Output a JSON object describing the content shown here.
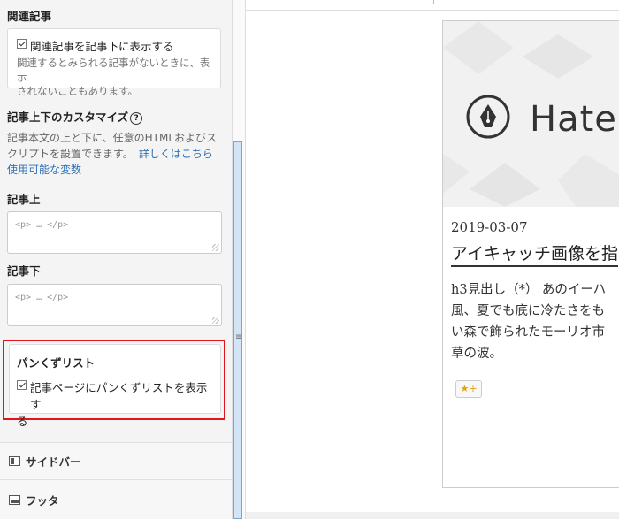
{
  "sidebar": {
    "related": {
      "heading": "関連記事",
      "checkbox_label": "関連記事を記事下に表示する",
      "hint_line1": "関連するとみられる記事がないときに、表示",
      "hint_line2": "されないこともあります。"
    },
    "customize": {
      "heading": "記事上下のカスタマイズ",
      "help_icon": "?",
      "desc_line1": "記事本文の上と下に、任意のHTMLおよびス",
      "desc_line2": "クリプトを設置できます。",
      "details_link": "詳しくはこちら",
      "vars_link": "使用可能な変数"
    },
    "above": {
      "label": "記事上",
      "placeholder": "<p> … </p>"
    },
    "below": {
      "label": "記事下",
      "placeholder": "<p> … </p>"
    },
    "breadcrumb": {
      "heading": "パンくずリスト",
      "checkbox_line1": "記事ページにパンくずリストを表示す",
      "checkbox_line2": "る"
    },
    "nav": [
      {
        "label": "サイドバー",
        "icon": "sidebar-layout-icon"
      },
      {
        "label": "フッタ",
        "icon": "footer-layout-icon"
      }
    ]
  },
  "splitter": {
    "icon": "≡"
  },
  "preview": {
    "logo_text": "Hate",
    "date": "2019-03-07",
    "title": "アイキャッチ画像を指",
    "body_lines": [
      "h3見出し（*） あのイーハ",
      "風、夏でも底に冷たさをも",
      "い森で飾られたモーリオ市",
      "草の波。"
    ],
    "star_button": "★+"
  },
  "colors": {
    "highlight": "#e0161d",
    "link": "#2a6fb7",
    "title_underline": "#333333"
  }
}
